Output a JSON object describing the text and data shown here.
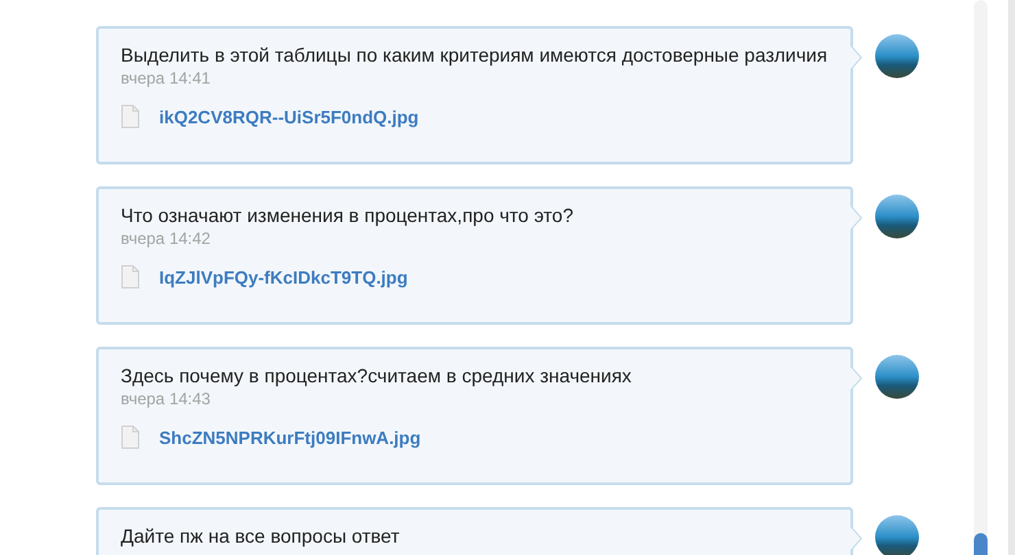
{
  "messages": [
    {
      "text": "Выделить в этой таблицы по каким критериям имеются достоверные различия",
      "time": "вчера 14:41",
      "file": "ikQ2CV8RQR--UiSr5F0ndQ.jpg"
    },
    {
      "text": "Что означают изменения в процентах,про что это?",
      "time": "вчера 14:42",
      "file": "IqZJlVpFQy-fKcIDkcT9TQ.jpg"
    },
    {
      "text": "Здесь почему в процентах?считаем в средних значениях",
      "time": "вчера 14:43",
      "file": "ShcZN5NPRKurFtj09IFnwA.jpg"
    },
    {
      "text": "Дайте пж на все вопросы ответ"
    }
  ]
}
